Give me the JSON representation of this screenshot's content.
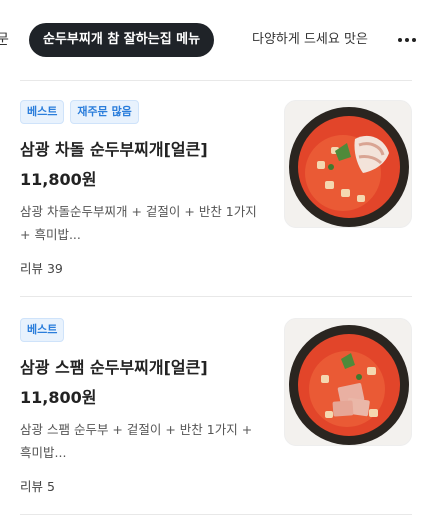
{
  "tabs": {
    "prev_cut": "문",
    "active": "순두부찌개 참 잘하는집 메뉴",
    "next": "다양하게 드세요 맛은"
  },
  "items": [
    {
      "badges": [
        "베스트",
        "재주문 많음"
      ],
      "name": "삼광 차돌 순두부찌개[얼큰]",
      "price": "11,800원",
      "desc": "삼광 차돌순두부찌개 + 겉절이 + 반찬 1가지 + 흑미밥...",
      "review": "리뷰 39",
      "thumb_icon": "sundubu-chadol-photo"
    },
    {
      "badges": [
        "베스트"
      ],
      "name": "삼광 스팸 순두부찌개[얼큰]",
      "price": "11,800원",
      "desc": "삼광 스팸 순두부 + 겉절이 + 반찬 1가지 + 흑미밥...",
      "review": "리뷰 5",
      "thumb_icon": "sundubu-spam-photo"
    }
  ]
}
